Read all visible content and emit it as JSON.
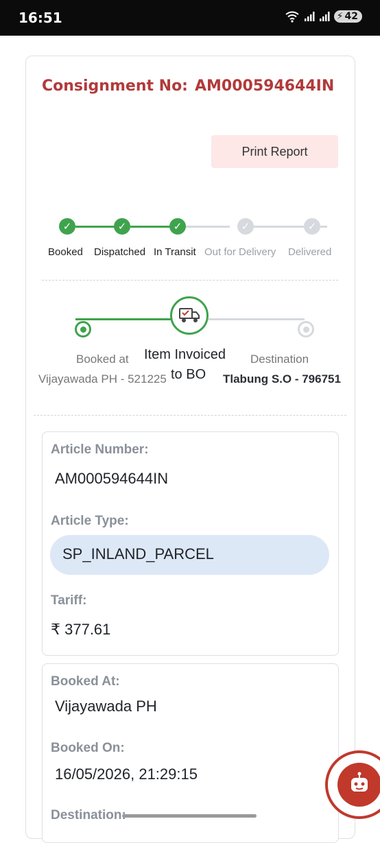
{
  "status_bar": {
    "time": "16:51",
    "battery": "42"
  },
  "consignment": {
    "label": "Consignment No:",
    "number": "AM000594644IN"
  },
  "print_button": "Print Report",
  "steps": [
    {
      "label": "Booked",
      "done": true
    },
    {
      "label": "Dispatched",
      "done": true
    },
    {
      "label": "In Transit",
      "done": true
    },
    {
      "label": "Out for Delivery",
      "done": false
    },
    {
      "label": "Delivered",
      "done": false
    }
  ],
  "route": {
    "origin_label": "Booked at",
    "origin_place": "Vijayawada PH - 521225",
    "current_line1": "Item Invoiced",
    "current_line2": "to BO",
    "destination_label": "Destination",
    "destination_place": "Tlabung S.O - 796751"
  },
  "details": {
    "article_number_label": "Article Number:",
    "article_number": "AM000594644IN",
    "article_type_label": "Article Type:",
    "article_type": "SP_INLAND_PARCEL",
    "tariff_label": "Tariff:",
    "tariff": "₹ 377.61",
    "booked_at_label": "Booked At:",
    "booked_at": "Vijayawada PH",
    "booked_on_label": "Booked On:",
    "booked_on": "16/05/2026, 21:29:15",
    "destination_label": "Destination:"
  },
  "colors": {
    "accent_red": "#b23a3a",
    "done_green": "#3fa34d",
    "pending_grey": "#d6d9de"
  }
}
